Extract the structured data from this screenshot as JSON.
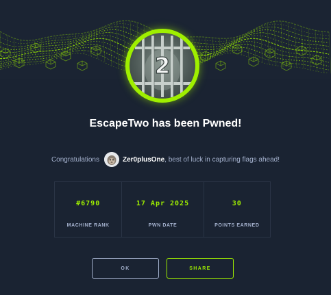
{
  "colors": {
    "background": "#1a2332",
    "accent": "#9fef00",
    "text_muted": "#a4b1cd",
    "text_primary": "#ffffff"
  },
  "banner": {
    "icon": "green-network-wave-graphic"
  },
  "badge": {
    "icon": "machine-avatar-number-2-behind-bars",
    "number": "2"
  },
  "title": "EscapeTwo has been Pwned!",
  "congrats": {
    "prefix": "Congratulations",
    "username": "Zer0plusOne",
    "suffix": ", best of luck in capturing flags ahead!",
    "avatar_icon": "monkey-avatar"
  },
  "stats": [
    {
      "value": "#6790",
      "label": "MACHINE RANK"
    },
    {
      "value": "17 Apr 2025",
      "label": "PWN DATE"
    },
    {
      "value": "30",
      "label": "POINTS EARNED"
    }
  ],
  "buttons": {
    "ok": "OK",
    "share": "SHARE"
  }
}
